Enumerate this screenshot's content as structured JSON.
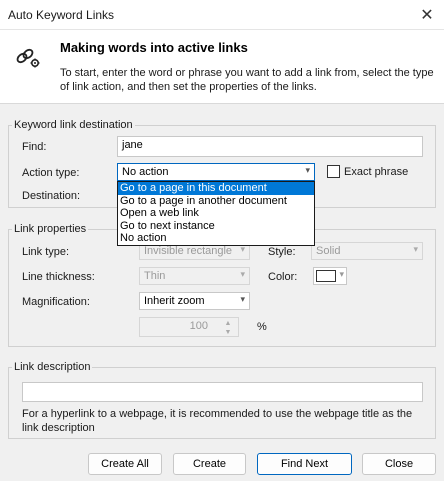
{
  "window": {
    "title": "Auto Keyword Links"
  },
  "header": {
    "title": "Making words into active links",
    "description": "To start, enter the word or phrase you want to add a link from, select the type of link action, and then set the properties of the links."
  },
  "destination_group": {
    "label": "Keyword link destination",
    "find_label": "Find:",
    "find_value": "jane",
    "action_type_label": "Action type:",
    "action_type_value": "No action",
    "exact_phrase_label": "Exact phrase",
    "destination_label": "Destination:",
    "action_options": [
      "Go to a page in this document",
      "Go to a page in another document",
      "Open a web link",
      "Go to next instance",
      "No action"
    ]
  },
  "properties_group": {
    "label": "Link properties",
    "link_type_label": "Link type:",
    "link_type_value": "Invisible rectangle",
    "style_label": "Style:",
    "style_value": "Solid",
    "line_thickness_label": "Line thickness:",
    "line_thickness_value": "Thin",
    "color_label": "Color:",
    "magnification_label": "Magnification:",
    "magnification_value": "Inherit zoom",
    "zoom_value": "100",
    "zoom_unit": "%"
  },
  "description_group": {
    "label": "Link description",
    "value": "",
    "hint": "For a hyperlink to a webpage, it is recommended to use the webpage title as the link description"
  },
  "buttons": {
    "create_all": "Create All",
    "create": "Create",
    "find_next": "Find Next",
    "close": "Close"
  },
  "colors": {
    "selection": "#0078d7",
    "accent_border": "#0067c0",
    "background": "#f0f0f0"
  }
}
